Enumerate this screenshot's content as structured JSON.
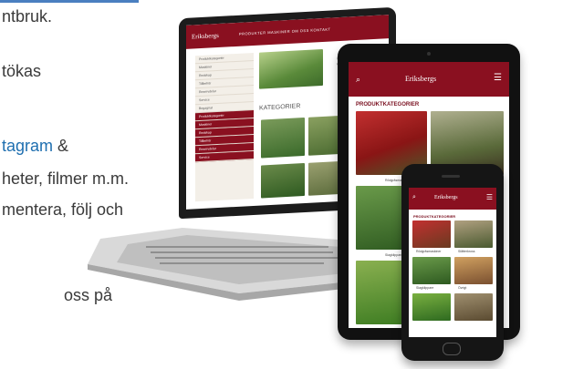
{
  "article": {
    "line1": "ntbruk.",
    "line2": "tökas",
    "line3_link": "tagram",
    "line3_rest": " &",
    "line4": "heter, filmer m.m.",
    "line5": "mentera, följ och",
    "line6": "oss   på"
  },
  "laptop_site": {
    "logo": "Eriksbergs",
    "nav": "PRODUKTER   MASKINER   OM OSS   KONTAKT",
    "banner_text": "SI",
    "section_title": "KATEGORIER",
    "sidebar_items": [
      "Produktkategorier",
      "Maskiner",
      "Redskap",
      "Tillbehör",
      "Reservdelar",
      "Service",
      "Begagnat",
      "Nyheter",
      "Kontakt"
    ],
    "red_items": [
      "Produktkategorier",
      "Maskiner",
      "Redskap",
      "Tillbehör",
      "Reservdelar",
      "Service"
    ]
  },
  "tablet_site": {
    "logo": "Eriksbergs",
    "title": "PRODUKTKATEGORIER",
    "captions": [
      "Rödgräsmaskiner",
      "Slåtterkross",
      "Slagklippare"
    ]
  },
  "phone_site": {
    "logo": "Eriksbergs",
    "title": "PRODUKTKATEGORIER",
    "captions": [
      "Rödgräsmaskiner",
      "Slåtterkross",
      "Slagklippare",
      "Övrigt"
    ]
  },
  "colors": {
    "brand_red": "#8a1020",
    "link_blue": "#1f6fb0",
    "device_black": "#151515"
  }
}
